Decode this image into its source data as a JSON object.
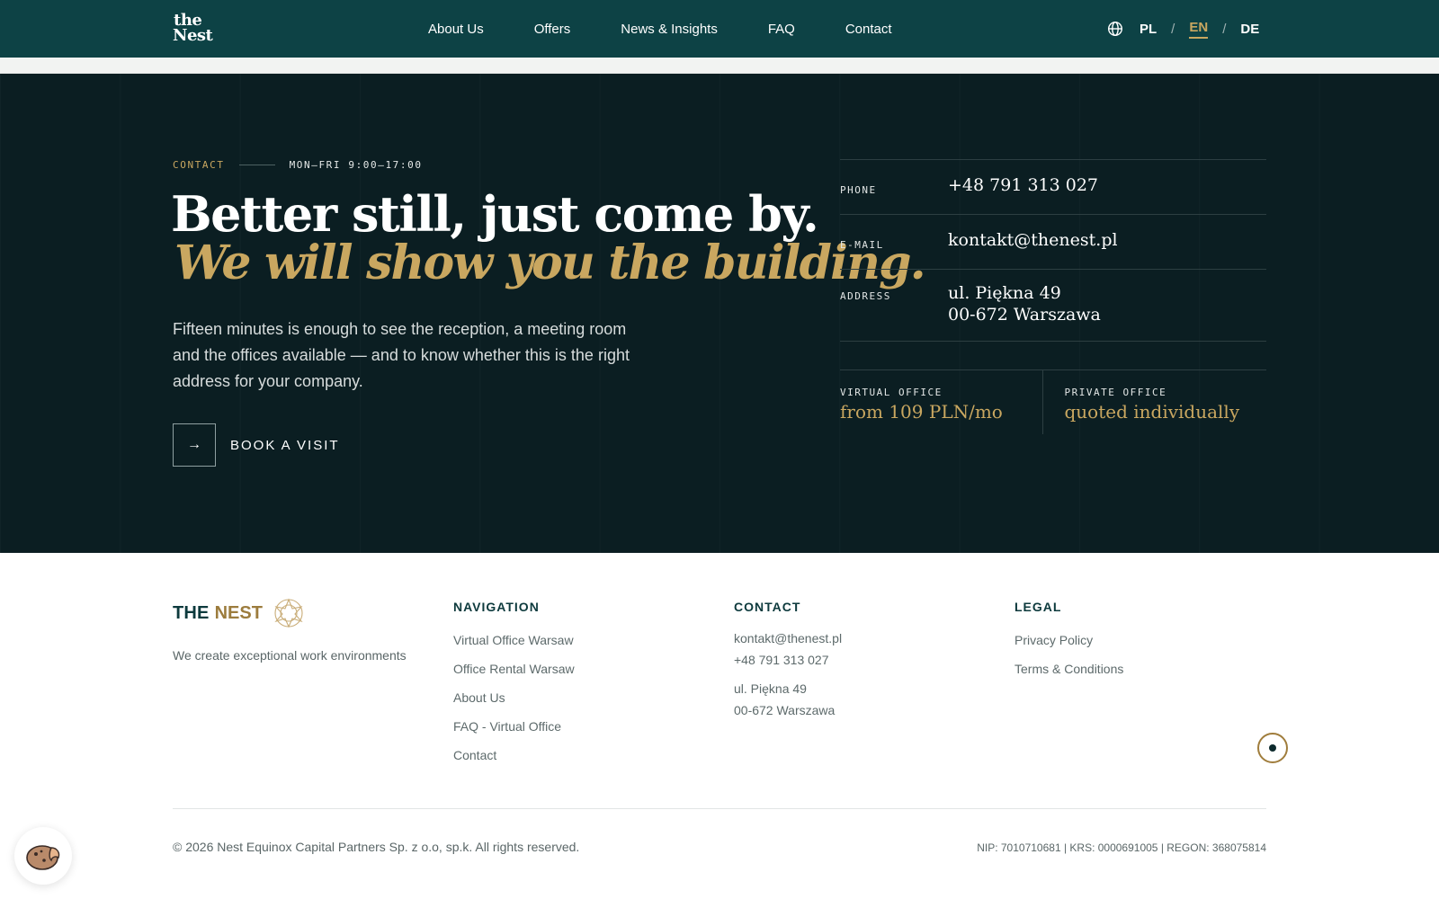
{
  "header": {
    "logo_line1": "the",
    "logo_line2": "Nest",
    "nav": [
      "About Us",
      "Offers",
      "News & Insights",
      "FAQ",
      "Contact"
    ],
    "languages": [
      "PL",
      "EN",
      "DE"
    ],
    "active_language": "EN"
  },
  "hero": {
    "eyebrow_label": "CONTACT",
    "eyebrow_hours": "MON–FRI 9:00–17:00",
    "headline": "Better still, just come by.",
    "headline_italic": "We will show you the building.",
    "lede": "Fifteen minutes is enough to see the reception, a meeting room and the offices available — and to know whether this is the right address for your company.",
    "cta_arrow": "→",
    "cta_label": "BOOK A VISIT"
  },
  "info": {
    "phone_label": "PHONE",
    "phone": "+48 791 313 027",
    "email_label": "E-MAIL",
    "email": "kontakt@thenest.pl",
    "address_label": "ADDRESS",
    "address_line1": "ul. Piękna 49",
    "address_line2": "00-672 Warszawa",
    "virtual_label": "VIRTUAL OFFICE",
    "virtual_price": "from 109 PLN/mo",
    "private_label": "PRIVATE OFFICE",
    "private_price": "quoted individually"
  },
  "footer": {
    "brand_1": "THE",
    "brand_2": "NEST",
    "tagline": "We create exceptional work environments",
    "nav_title": "NAVIGATION",
    "nav_links": [
      "Virtual Office Warsaw",
      "Office Rental Warsaw",
      "About Us",
      "FAQ - Virtual Office",
      "Contact"
    ],
    "contact_title": "CONTACT",
    "contact_email": "kontakt@thenest.pl",
    "contact_phone": "+48 791 313 027",
    "contact_addr1": "ul. Piękna 49",
    "contact_addr2": "00-672 Warszawa",
    "legal_title": "LEGAL",
    "legal_links": [
      "Privacy Policy",
      "Terms & Conditions"
    ],
    "copyright": "© 2026 Nest Equinox Capital Partners Sp. z o.o, sp.k. All rights reserved.",
    "registry": "NIP: 7010710681 | KRS: 0000691005 | REGON: 368075814"
  },
  "colors": {
    "header_bg": "#0d4245",
    "hero_bg": "#0b1e22",
    "accent_gold": "#c9a760",
    "brand_teal": "#0d3a3d"
  }
}
